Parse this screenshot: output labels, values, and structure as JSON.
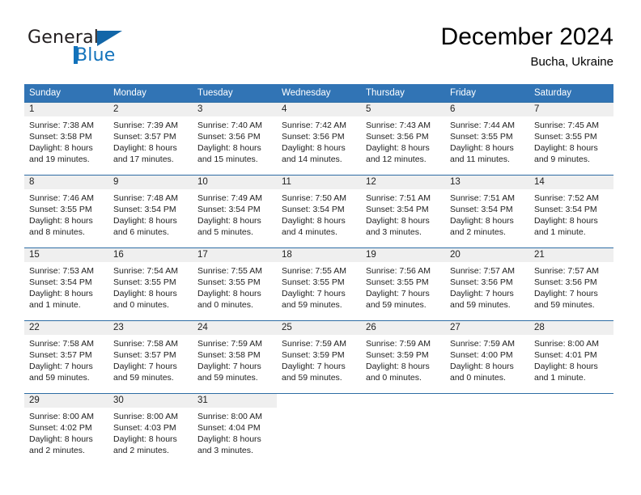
{
  "brand": {
    "name_part1": "General",
    "name_part2": "Blue",
    "logo_icon": "triangle-flag-icon"
  },
  "header": {
    "title": "December 2024",
    "subtitle": "Bucha, Ukraine"
  },
  "colors": {
    "header_blue": "#3174b5",
    "row_divider_blue": "#2e6da4",
    "daynum_strip": "#efefef",
    "brand_blue": "#1272bb",
    "text": "#222222"
  },
  "weekday_headers": [
    "Sunday",
    "Monday",
    "Tuesday",
    "Wednesday",
    "Thursday",
    "Friday",
    "Saturday"
  ],
  "weeks": [
    [
      {
        "day": "1",
        "sunrise": "Sunrise: 7:38 AM",
        "sunset": "Sunset: 3:58 PM",
        "daylight_line1": "Daylight: 8 hours",
        "daylight_line2": "and 19 minutes."
      },
      {
        "day": "2",
        "sunrise": "Sunrise: 7:39 AM",
        "sunset": "Sunset: 3:57 PM",
        "daylight_line1": "Daylight: 8 hours",
        "daylight_line2": "and 17 minutes."
      },
      {
        "day": "3",
        "sunrise": "Sunrise: 7:40 AM",
        "sunset": "Sunset: 3:56 PM",
        "daylight_line1": "Daylight: 8 hours",
        "daylight_line2": "and 15 minutes."
      },
      {
        "day": "4",
        "sunrise": "Sunrise: 7:42 AM",
        "sunset": "Sunset: 3:56 PM",
        "daylight_line1": "Daylight: 8 hours",
        "daylight_line2": "and 14 minutes."
      },
      {
        "day": "5",
        "sunrise": "Sunrise: 7:43 AM",
        "sunset": "Sunset: 3:56 PM",
        "daylight_line1": "Daylight: 8 hours",
        "daylight_line2": "and 12 minutes."
      },
      {
        "day": "6",
        "sunrise": "Sunrise: 7:44 AM",
        "sunset": "Sunset: 3:55 PM",
        "daylight_line1": "Daylight: 8 hours",
        "daylight_line2": "and 11 minutes."
      },
      {
        "day": "7",
        "sunrise": "Sunrise: 7:45 AM",
        "sunset": "Sunset: 3:55 PM",
        "daylight_line1": "Daylight: 8 hours",
        "daylight_line2": "and 9 minutes."
      }
    ],
    [
      {
        "day": "8",
        "sunrise": "Sunrise: 7:46 AM",
        "sunset": "Sunset: 3:55 PM",
        "daylight_line1": "Daylight: 8 hours",
        "daylight_line2": "and 8 minutes."
      },
      {
        "day": "9",
        "sunrise": "Sunrise: 7:48 AM",
        "sunset": "Sunset: 3:54 PM",
        "daylight_line1": "Daylight: 8 hours",
        "daylight_line2": "and 6 minutes."
      },
      {
        "day": "10",
        "sunrise": "Sunrise: 7:49 AM",
        "sunset": "Sunset: 3:54 PM",
        "daylight_line1": "Daylight: 8 hours",
        "daylight_line2": "and 5 minutes."
      },
      {
        "day": "11",
        "sunrise": "Sunrise: 7:50 AM",
        "sunset": "Sunset: 3:54 PM",
        "daylight_line1": "Daylight: 8 hours",
        "daylight_line2": "and 4 minutes."
      },
      {
        "day": "12",
        "sunrise": "Sunrise: 7:51 AM",
        "sunset": "Sunset: 3:54 PM",
        "daylight_line1": "Daylight: 8 hours",
        "daylight_line2": "and 3 minutes."
      },
      {
        "day": "13",
        "sunrise": "Sunrise: 7:51 AM",
        "sunset": "Sunset: 3:54 PM",
        "daylight_line1": "Daylight: 8 hours",
        "daylight_line2": "and 2 minutes."
      },
      {
        "day": "14",
        "sunrise": "Sunrise: 7:52 AM",
        "sunset": "Sunset: 3:54 PM",
        "daylight_line1": "Daylight: 8 hours",
        "daylight_line2": "and 1 minute."
      }
    ],
    [
      {
        "day": "15",
        "sunrise": "Sunrise: 7:53 AM",
        "sunset": "Sunset: 3:54 PM",
        "daylight_line1": "Daylight: 8 hours",
        "daylight_line2": "and 1 minute."
      },
      {
        "day": "16",
        "sunrise": "Sunrise: 7:54 AM",
        "sunset": "Sunset: 3:55 PM",
        "daylight_line1": "Daylight: 8 hours",
        "daylight_line2": "and 0 minutes."
      },
      {
        "day": "17",
        "sunrise": "Sunrise: 7:55 AM",
        "sunset": "Sunset: 3:55 PM",
        "daylight_line1": "Daylight: 8 hours",
        "daylight_line2": "and 0 minutes."
      },
      {
        "day": "18",
        "sunrise": "Sunrise: 7:55 AM",
        "sunset": "Sunset: 3:55 PM",
        "daylight_line1": "Daylight: 7 hours",
        "daylight_line2": "and 59 minutes."
      },
      {
        "day": "19",
        "sunrise": "Sunrise: 7:56 AM",
        "sunset": "Sunset: 3:55 PM",
        "daylight_line1": "Daylight: 7 hours",
        "daylight_line2": "and 59 minutes."
      },
      {
        "day": "20",
        "sunrise": "Sunrise: 7:57 AM",
        "sunset": "Sunset: 3:56 PM",
        "daylight_line1": "Daylight: 7 hours",
        "daylight_line2": "and 59 minutes."
      },
      {
        "day": "21",
        "sunrise": "Sunrise: 7:57 AM",
        "sunset": "Sunset: 3:56 PM",
        "daylight_line1": "Daylight: 7 hours",
        "daylight_line2": "and 59 minutes."
      }
    ],
    [
      {
        "day": "22",
        "sunrise": "Sunrise: 7:58 AM",
        "sunset": "Sunset: 3:57 PM",
        "daylight_line1": "Daylight: 7 hours",
        "daylight_line2": "and 59 minutes."
      },
      {
        "day": "23",
        "sunrise": "Sunrise: 7:58 AM",
        "sunset": "Sunset: 3:57 PM",
        "daylight_line1": "Daylight: 7 hours",
        "daylight_line2": "and 59 minutes."
      },
      {
        "day": "24",
        "sunrise": "Sunrise: 7:59 AM",
        "sunset": "Sunset: 3:58 PM",
        "daylight_line1": "Daylight: 7 hours",
        "daylight_line2": "and 59 minutes."
      },
      {
        "day": "25",
        "sunrise": "Sunrise: 7:59 AM",
        "sunset": "Sunset: 3:59 PM",
        "daylight_line1": "Daylight: 7 hours",
        "daylight_line2": "and 59 minutes."
      },
      {
        "day": "26",
        "sunrise": "Sunrise: 7:59 AM",
        "sunset": "Sunset: 3:59 PM",
        "daylight_line1": "Daylight: 8 hours",
        "daylight_line2": "and 0 minutes."
      },
      {
        "day": "27",
        "sunrise": "Sunrise: 7:59 AM",
        "sunset": "Sunset: 4:00 PM",
        "daylight_line1": "Daylight: 8 hours",
        "daylight_line2": "and 0 minutes."
      },
      {
        "day": "28",
        "sunrise": "Sunrise: 8:00 AM",
        "sunset": "Sunset: 4:01 PM",
        "daylight_line1": "Daylight: 8 hours",
        "daylight_line2": "and 1 minute."
      }
    ],
    [
      {
        "day": "29",
        "sunrise": "Sunrise: 8:00 AM",
        "sunset": "Sunset: 4:02 PM",
        "daylight_line1": "Daylight: 8 hours",
        "daylight_line2": "and 2 minutes."
      },
      {
        "day": "30",
        "sunrise": "Sunrise: 8:00 AM",
        "sunset": "Sunset: 4:03 PM",
        "daylight_line1": "Daylight: 8 hours",
        "daylight_line2": "and 2 minutes."
      },
      {
        "day": "31",
        "sunrise": "Sunrise: 8:00 AM",
        "sunset": "Sunset: 4:04 PM",
        "daylight_line1": "Daylight: 8 hours",
        "daylight_line2": "and 3 minutes."
      },
      {
        "day": "",
        "sunrise": "",
        "sunset": "",
        "daylight_line1": "",
        "daylight_line2": ""
      },
      {
        "day": "",
        "sunrise": "",
        "sunset": "",
        "daylight_line1": "",
        "daylight_line2": ""
      },
      {
        "day": "",
        "sunrise": "",
        "sunset": "",
        "daylight_line1": "",
        "daylight_line2": ""
      },
      {
        "day": "",
        "sunrise": "",
        "sunset": "",
        "daylight_line1": "",
        "daylight_line2": ""
      }
    ]
  ]
}
